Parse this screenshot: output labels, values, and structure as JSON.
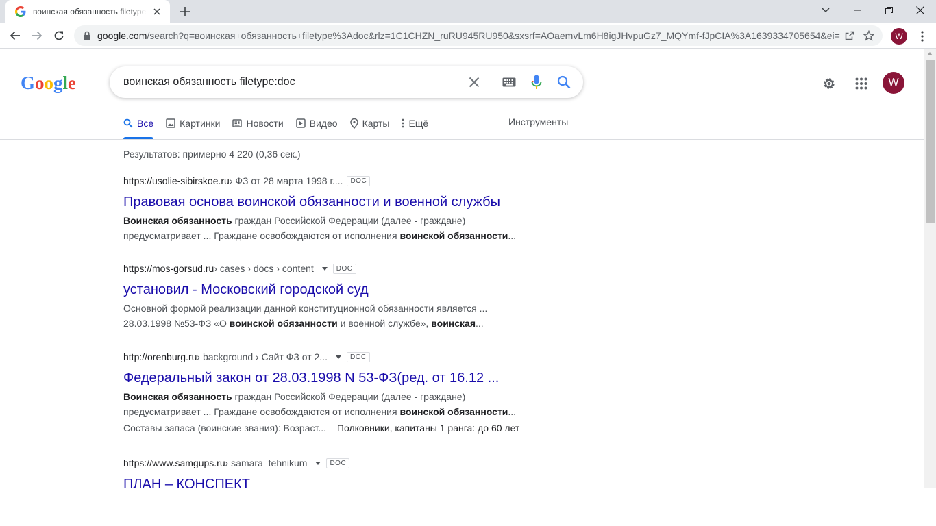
{
  "browser": {
    "tab_title": "воинская обязанность filetype:doc - Поиск в Google",
    "url_host": "google.com",
    "url_rest": "/search?q=воинская+обязанность+filetype%3Adoc&rlz=1C1CHZN_ruRU945RU950&sxsrf=AOaemvLm6H8igJHvpuGz7_MQYmf-fJpCIA%3A1639334705654&ei=...",
    "profile_initial": "W"
  },
  "search": {
    "query": "воинская обязанность filetype:doc"
  },
  "tabs": [
    {
      "label": "Все",
      "icon": "search-icon"
    },
    {
      "label": "Картинки",
      "icon": "image-icon"
    },
    {
      "label": "Новости",
      "icon": "news-icon"
    },
    {
      "label": "Видео",
      "icon": "video-icon"
    },
    {
      "label": "Карты",
      "icon": "map-pin-icon"
    },
    {
      "label": "Ещё",
      "icon": "more-vert-icon"
    }
  ],
  "tools_label": "Инструменты",
  "stats": "Результатов: примерно 4 220 (0,36 сек.)",
  "user_initial": "W",
  "results": [
    {
      "domain": "https://usolie-sibirskoe.ru",
      "crumbs": " › ФЗ от 28 марта 1998 г....",
      "badge": "DOC",
      "title": "Правовая основа воинской обязанности и военной службы",
      "line1": [
        [
          "b",
          "Воинская обязанность"
        ],
        [
          "t",
          " граждан Российской Федерации (далее - граждане)"
        ]
      ],
      "line2": [
        [
          "t",
          "предусматривает ... Граждане освобождаются от исполнения "
        ],
        [
          "b",
          "воинской обязанности"
        ],
        [
          "t",
          "..."
        ]
      ]
    },
    {
      "domain": "https://mos-gorsud.ru",
      "crumbs": " › cases › docs › content",
      "badge": "DOC",
      "title": "установил - Московский городской суд",
      "line1": [
        [
          "t",
          "Основной формой реализации данной конституционной обязанности является ..."
        ]
      ],
      "line2": [
        [
          "t",
          "28.03.1998 №53-ФЗ «О "
        ],
        [
          "b",
          "воинской обязанности"
        ],
        [
          "t",
          " и военной службе», "
        ],
        [
          "b",
          "воинская"
        ],
        [
          "t",
          "..."
        ]
      ]
    },
    {
      "domain": "http://orenburg.ru",
      "crumbs": " › background › Сайт ФЗ от 2...",
      "badge": "DOC",
      "title": "Федеральный закон от 28.03.1998 N 53-ФЗ(ред. от 16.12 ...",
      "line1": [
        [
          "b",
          "Воинская обязанность"
        ],
        [
          "t",
          " граждан Российской Федерации (далее - граждане)"
        ]
      ],
      "line2": [
        [
          "t",
          "предусматривает ... Граждане освобождаются от исполнения "
        ],
        [
          "b",
          "воинской обязанности"
        ],
        [
          "t",
          "..."
        ]
      ],
      "extra_label": "Составы запаса (воинские звания): Возраст...",
      "extra_value": "Полковники, капитаны 1 ранга: до 60 лет"
    },
    {
      "domain": "https://www.samgups.ru",
      "crumbs": " › samara_tehnikum",
      "badge": "DOC",
      "title": "ПЛАН – КОНСПЕКТ"
    }
  ]
}
